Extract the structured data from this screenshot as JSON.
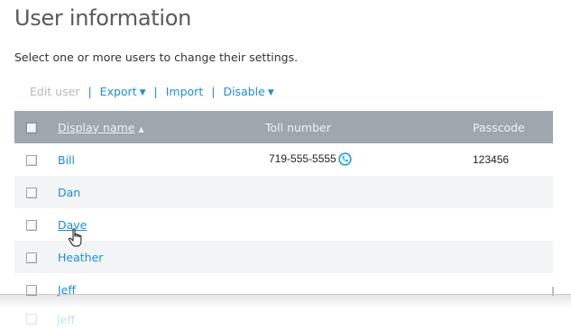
{
  "page": {
    "title": "User information",
    "subtitle": "Select one or more users to change their settings."
  },
  "toolbar": {
    "edit_user": "Edit user",
    "export": "Export",
    "import": "Import",
    "disable": "Disable",
    "separator": "|",
    "dropdown_caret": "▼"
  },
  "table": {
    "headers": {
      "display_name": "Display name",
      "toll_number": "Toll number",
      "passcode": "Passcode",
      "sort_indicator": "▲"
    },
    "rows": [
      {
        "name": "Bill",
        "toll_number": "719-555-5555",
        "passcode": "123456",
        "has_call_icon": true
      },
      {
        "name": "Dan",
        "toll_number": "",
        "passcode": ""
      },
      {
        "name": "Dave",
        "toll_number": "",
        "passcode": "",
        "hovered": true
      },
      {
        "name": "Heather",
        "toll_number": "",
        "passcode": ""
      },
      {
        "name": "Jeff",
        "toll_number": "",
        "passcode": ""
      }
    ],
    "partial_row": {
      "name": "Jeff"
    }
  },
  "colors": {
    "link": "#1f8ed6",
    "header_bg": "#9ea6ae",
    "disabled_text": "#b8b8b8",
    "alt_row": "#f2f4f6"
  }
}
